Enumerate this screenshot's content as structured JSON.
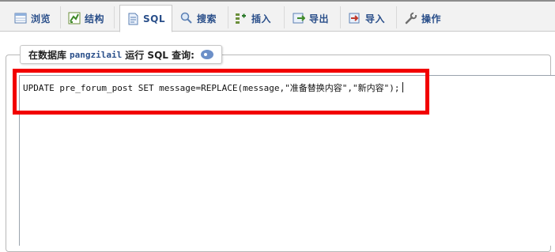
{
  "tabs": [
    {
      "id": "browse",
      "label": "浏览",
      "icon": "table-browse-icon"
    },
    {
      "id": "structure",
      "label": "结构",
      "icon": "structure-icon"
    },
    {
      "id": "sql",
      "label": "SQL",
      "icon": "sql-page-icon",
      "active": true
    },
    {
      "id": "search",
      "label": "搜索",
      "icon": "magnifier-icon"
    },
    {
      "id": "insert",
      "label": "插入",
      "icon": "insert-icon"
    },
    {
      "id": "export",
      "label": "导出",
      "icon": "export-icon"
    },
    {
      "id": "import",
      "label": "导入",
      "icon": "import-icon"
    },
    {
      "id": "operations",
      "label": "操作",
      "icon": "wrench-icon"
    }
  ],
  "sql_panel": {
    "legend_prefix": "在数据库",
    "database": "pangzilail",
    "legend_suffix": "运行 SQL 查询:",
    "help_icon": "help-icon",
    "query": "UPDATE pre_forum_post SET message=REPLACE(message,\"准备替换内容\",\"新内容\");"
  },
  "colors": {
    "tab_text": "#2a4f8a",
    "highlight_box": "#f20000",
    "tabbar_bg": "#f2f2f2"
  }
}
